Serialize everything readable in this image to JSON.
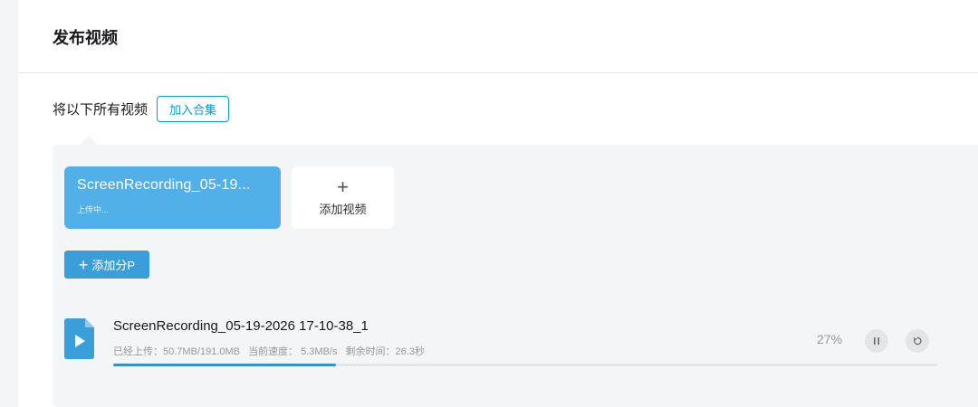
{
  "header": {
    "title": "发布视频"
  },
  "collection": {
    "label": "将以下所有视频",
    "button_label": "加入合集"
  },
  "video_cards": [
    {
      "title": "ScreenRecording_05-19...",
      "status": "上传中..."
    }
  ],
  "add_video": {
    "icon": "plus-icon",
    "label": "添加视频"
  },
  "add_part": {
    "icon": "plus-icon",
    "label": "添加分P"
  },
  "upload": {
    "file_icon": "video-file-icon",
    "filename": "ScreenRecording_05-19-2026 17-10-38_1",
    "uploaded": "已经上传：50.7MB/191.0MB",
    "speed": "当前速度： 5.3MB/s",
    "remaining": "剩余时间：26.3秒",
    "percent_text": "27%",
    "progress": 0.27,
    "pause_icon": "pause-icon",
    "retry_icon": "retry-icon"
  },
  "colors": {
    "accent": "#00a1d6",
    "card_blue": "#52b0e8",
    "button_blue": "#3a9fd8",
    "progress_blue": "#2f92d1",
    "panel_bg": "#f4f5f7"
  }
}
